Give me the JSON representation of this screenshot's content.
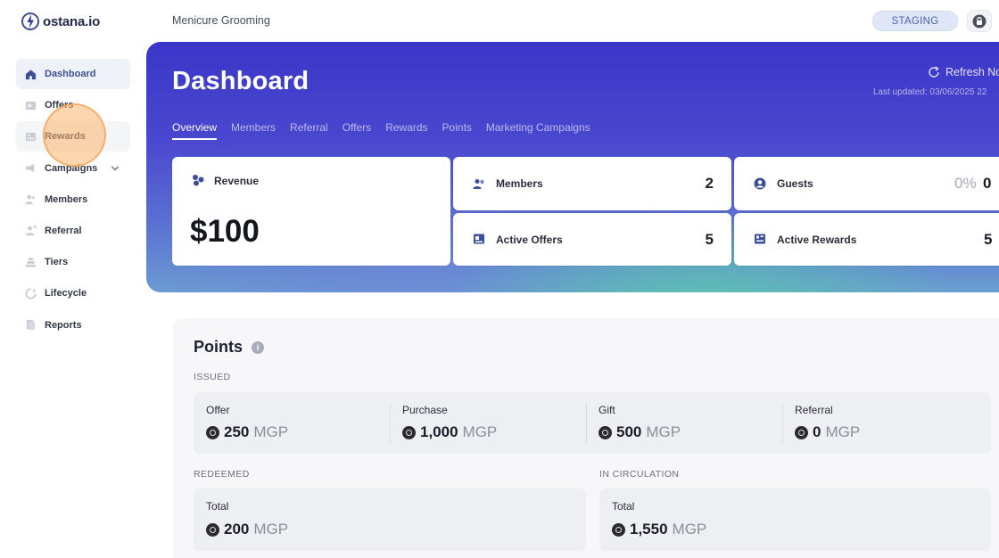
{
  "app": {
    "logo_text": "ostana.io",
    "org_name": "Menicure Grooming",
    "env_badge": "STAGING"
  },
  "sidebar": {
    "items": [
      {
        "label": "Dashboard",
        "icon": "home-icon"
      },
      {
        "label": "Offers",
        "icon": "offer-icon"
      },
      {
        "label": "Rewards",
        "icon": "reward-icon"
      },
      {
        "label": "Campaigns",
        "icon": "campaign-icon"
      },
      {
        "label": "Members",
        "icon": "members-icon"
      },
      {
        "label": "Referral",
        "icon": "referral-icon"
      },
      {
        "label": "Tiers",
        "icon": "tiers-icon"
      },
      {
        "label": "Lifecycle",
        "icon": "lifecycle-icon"
      },
      {
        "label": "Reports",
        "icon": "reports-icon"
      }
    ]
  },
  "hero": {
    "title": "Dashboard",
    "refresh_label": "Refresh No",
    "last_updated": "Last updated: 03/06/2025 22",
    "tabs": [
      "Overview",
      "Members",
      "Referral",
      "Offers",
      "Rewards",
      "Points",
      "Marketing Campaigns"
    ],
    "active_tab": "Overview"
  },
  "cards": {
    "revenue": {
      "label": "Revenue",
      "value": "$100"
    },
    "members": {
      "label": "Members",
      "value": "2"
    },
    "guests": {
      "label": "Guests",
      "pct": "0%",
      "value": "0"
    },
    "active_offers": {
      "label": "Active Offers",
      "value": "5"
    },
    "active_rewards": {
      "label": "Active Rewards",
      "value": "5"
    }
  },
  "points": {
    "title": "Points",
    "issued_label": "ISSUED",
    "issued": [
      {
        "label": "Offer",
        "value": "250",
        "unit": "MGP"
      },
      {
        "label": "Purchase",
        "value": "1,000",
        "unit": "MGP"
      },
      {
        "label": "Gift",
        "value": "500",
        "unit": "MGP"
      },
      {
        "label": "Referral",
        "value": "0",
        "unit": "MGP"
      }
    ],
    "redeemed_label": "REDEEMED",
    "redeemed": {
      "label": "Total",
      "value": "200",
      "unit": "MGP"
    },
    "circulation_label": "IN CIRCULATION",
    "circulation": {
      "label": "Total",
      "value": "1,550",
      "unit": "MGP"
    }
  },
  "colors": {
    "accent": "#3d4f99",
    "hero_top": "#3b36c9",
    "hero_teal": "#58c8aa",
    "staging_bg": "#dfe6f7"
  }
}
